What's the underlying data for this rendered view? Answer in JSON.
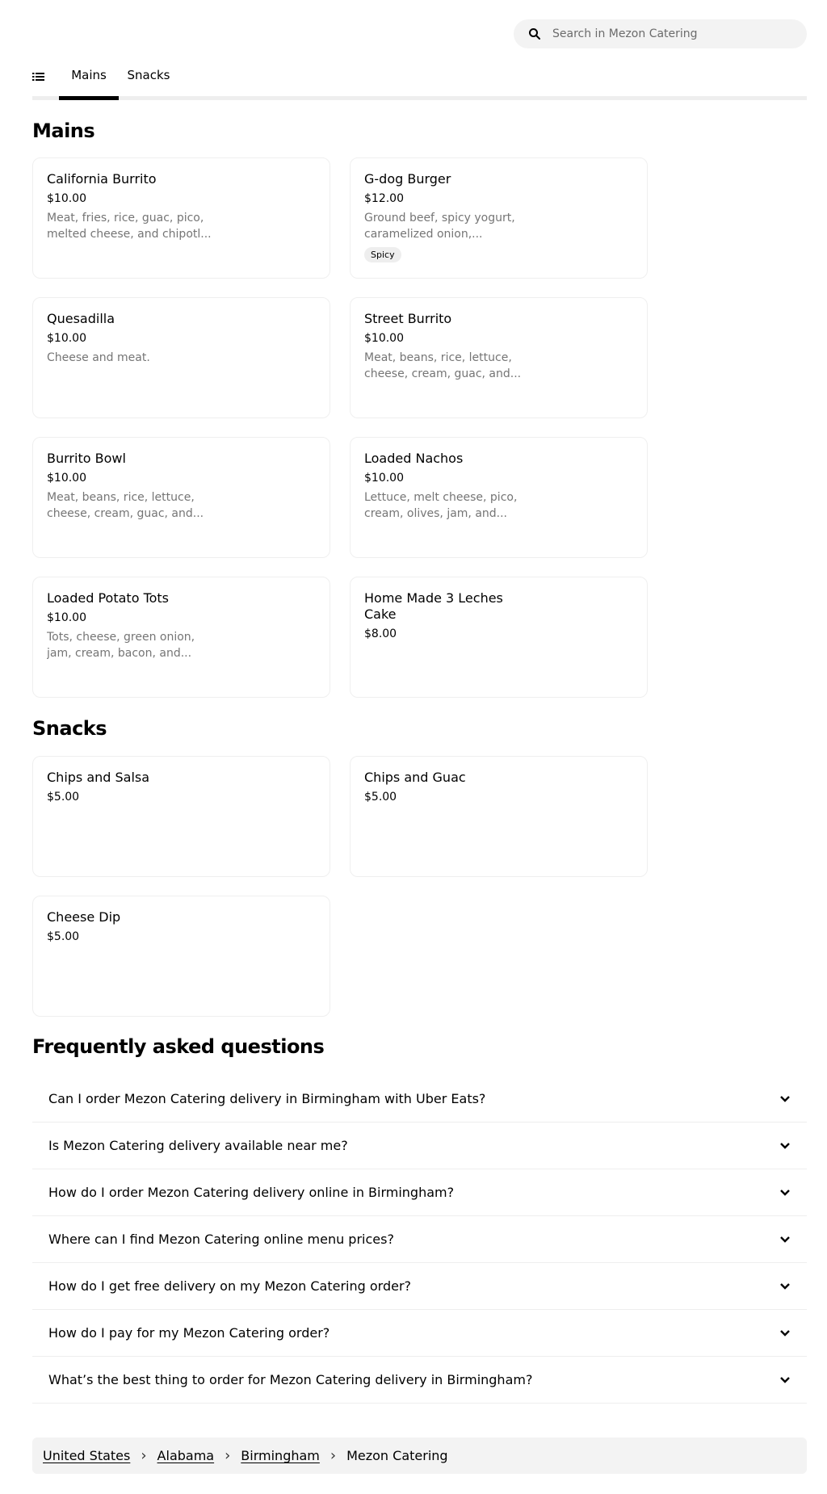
{
  "search": {
    "placeholder": "Search in Mezon Catering"
  },
  "tabs": [
    {
      "label": "Mains",
      "active": true
    },
    {
      "label": "Snacks",
      "active": false
    }
  ],
  "sections": {
    "mains": {
      "title": "Mains",
      "items": [
        {
          "name": "California Burrito",
          "price": "$10.00",
          "description": "Meat, fries, rice, guac, pico, melted cheese, and chipotl..."
        },
        {
          "name": "G-dog Burger",
          "price": "$12.00",
          "description": "Ground beef, spicy yogurt, caramelized onion,...",
          "badge": "Spicy"
        },
        {
          "name": "Quesadilla",
          "price": "$10.00",
          "description": "Cheese and meat."
        },
        {
          "name": "Street Burrito",
          "price": "$10.00",
          "description": "Meat, beans, rice, lettuce, cheese, cream, guac, and..."
        },
        {
          "name": "Burrito Bowl",
          "price": "$10.00",
          "description": "Meat, beans, rice, lettuce, cheese, cream, guac, and..."
        },
        {
          "name": "Loaded Nachos",
          "price": "$10.00",
          "description": "Lettuce, melt cheese, pico, cream, olives, jam, and..."
        },
        {
          "name": "Loaded Potato Tots",
          "price": "$10.00",
          "description": "Tots, cheese, green onion, jam, cream, bacon, and..."
        },
        {
          "name": "Home Made 3 Leches Cake",
          "price": "$8.00"
        }
      ]
    },
    "snacks": {
      "title": "Snacks",
      "items": [
        {
          "name": "Chips and Salsa",
          "price": "$5.00"
        },
        {
          "name": "Chips and Guac",
          "price": "$5.00"
        },
        {
          "name": "Cheese Dip",
          "price": "$5.00"
        }
      ]
    }
  },
  "faq": {
    "title": "Frequently asked questions",
    "questions": [
      "Can I order Mezon Catering delivery in Birmingham with Uber Eats?",
      "Is Mezon Catering delivery available near me?",
      "How do I order Mezon Catering delivery online in Birmingham?",
      "Where can I find Mezon Catering online menu prices?",
      "How do I get free delivery on my Mezon Catering order?",
      "How do I pay for my Mezon Catering order?",
      "What’s the best thing to order for Mezon Catering delivery in Birmingham?"
    ]
  },
  "breadcrumb": {
    "links": [
      "United States",
      "Alabama",
      "Birmingham"
    ],
    "current": "Mezon Catering"
  }
}
